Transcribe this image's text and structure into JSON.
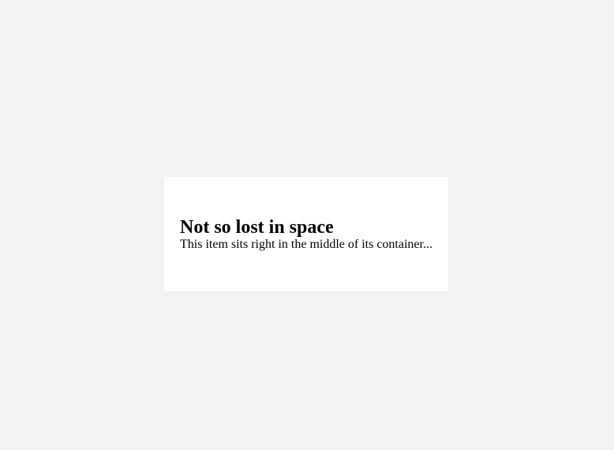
{
  "card": {
    "title": "Not so lost in space",
    "text": "This item sits right in the middle of its container..."
  },
  "colors": {
    "page_background": "#f2f2f2",
    "card_background": "#ffffff",
    "text": "#000000"
  }
}
